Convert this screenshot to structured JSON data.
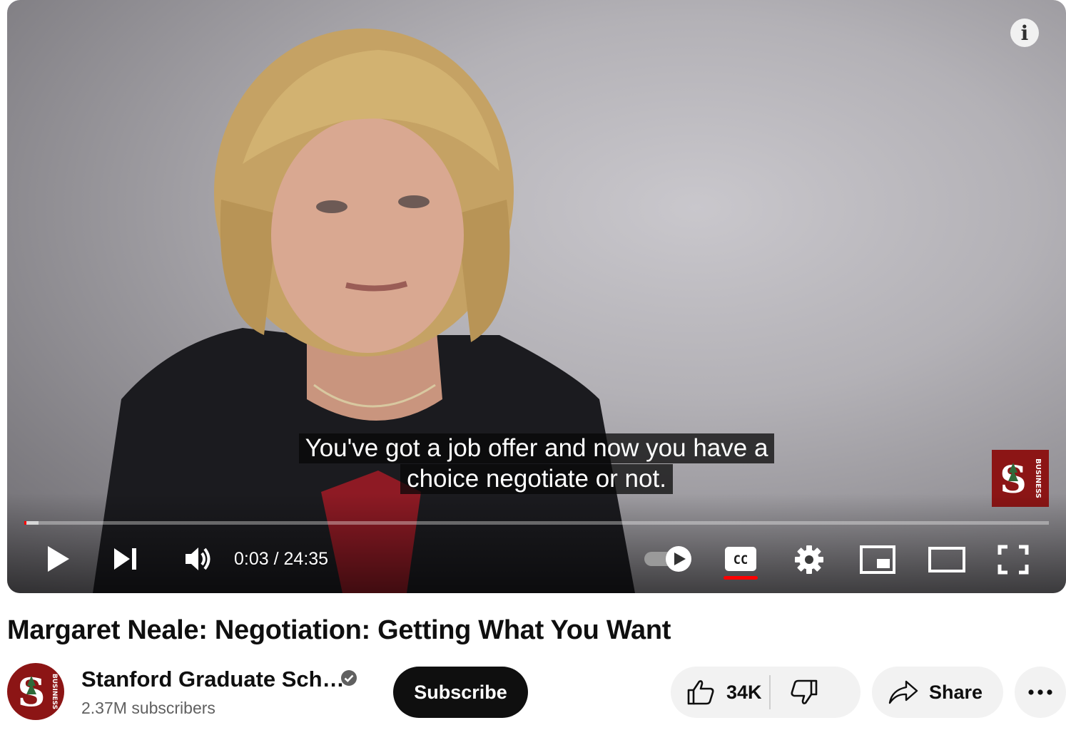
{
  "player": {
    "captions": [
      "You've got a job offer and now you have a",
      "choice negotiate or not."
    ],
    "time_current": "0:03",
    "time_separator": " / ",
    "time_total": "24:35",
    "progress_played_fraction": 0.002,
    "autoplay_on": true,
    "captions_on": true,
    "watermark_text": "BUSINESS"
  },
  "video": {
    "title": "Margaret Neale: Negotiation: Getting What You Want"
  },
  "channel": {
    "name": "Stanford Graduate Sch…",
    "subscribers": "2.37M subscribers",
    "verified": true,
    "avatar_text": "BUSINESS"
  },
  "actions": {
    "subscribe_label": "Subscribe",
    "like_count": "34K",
    "share_label": "Share"
  },
  "colors": {
    "stanford_cardinal": "#8c1515",
    "progress_red": "#ff0000",
    "pill_bg": "#f2f2f2",
    "subscribe_bg": "#0f0f0f"
  }
}
